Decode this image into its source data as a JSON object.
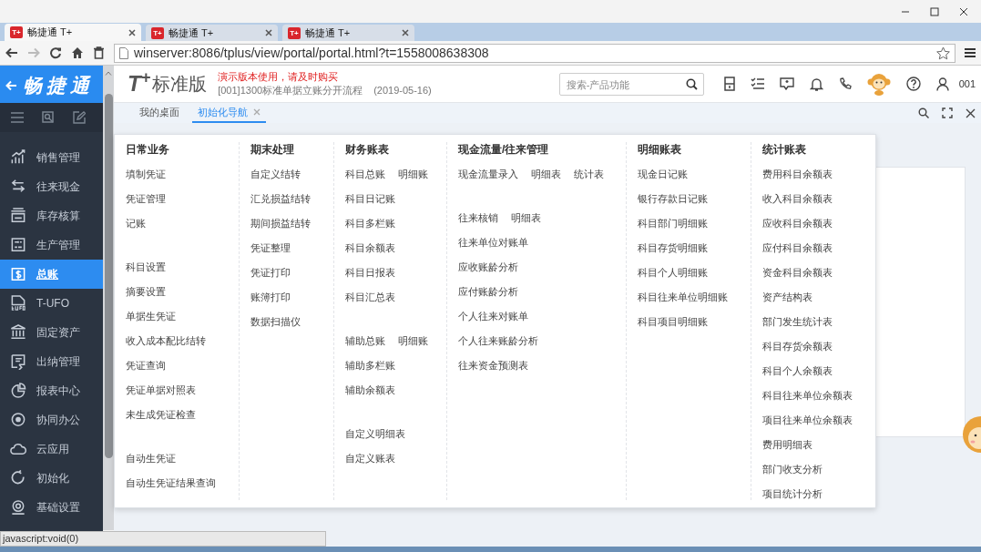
{
  "browser": {
    "tabs": [
      {
        "icon_text": "T+",
        "label": "畅捷通 T+",
        "selected": true
      },
      {
        "icon_text": "T+",
        "label": "畅捷通 T+",
        "selected": false
      },
      {
        "icon_text": "T+",
        "label": "畅捷通 T+",
        "selected": false
      }
    ],
    "address": "winserver:8086/tplus/view/portal/portal.html?t=1558008638308"
  },
  "header": {
    "brand": "畅捷通",
    "logo_mark": "T$^{+}$",
    "edition": "标准版",
    "notice": "演示版本使用，请及时购买",
    "account": "[001]1300标准单据立账分开流程",
    "date": "(2019-05-16)",
    "search": {
      "placeholder": "搜索-产品功能"
    },
    "user": "001"
  },
  "sidebar": {
    "items": [
      {
        "label": "销售管理",
        "selected": false
      },
      {
        "label": "往来现金",
        "selected": false
      },
      {
        "label": "库存核算",
        "selected": false
      },
      {
        "label": "生产管理",
        "selected": false
      },
      {
        "label": "总账",
        "selected": true
      },
      {
        "label": "T-UFO",
        "selected": false
      },
      {
        "label": "固定资产",
        "selected": false
      },
      {
        "label": "出纳管理",
        "selected": false
      },
      {
        "label": "报表中心",
        "selected": false
      },
      {
        "label": "协同办公",
        "selected": false
      },
      {
        "label": "云应用",
        "selected": false
      },
      {
        "label": "初始化",
        "selected": false
      },
      {
        "label": "基础设置",
        "selected": false
      }
    ]
  },
  "page_tabs": [
    {
      "label": "我的桌面",
      "selected": false,
      "closable": false
    },
    {
      "label": "初始化导航",
      "selected": true,
      "closable": true
    }
  ],
  "menu": {
    "columns": [
      {
        "heading": "日常业务",
        "groups": [
          [
            [
              "填制凭证"
            ],
            [
              "凭证管理"
            ],
            [
              "记账"
            ]
          ],
          [
            [
              "科目设置"
            ],
            [
              "摘要设置"
            ],
            [
              "单据生凭证"
            ],
            [
              "收入成本配比结转"
            ],
            [
              "凭证查询"
            ],
            [
              "凭证单据对照表"
            ],
            [
              "未生成凭证检查"
            ]
          ],
          [
            [
              "自动生凭证"
            ],
            [
              "自动生凭证结果查询"
            ]
          ]
        ]
      },
      {
        "heading": "期末处理",
        "groups": [
          [
            [
              "自定义结转"
            ],
            [
              "汇兑损益结转"
            ],
            [
              "期间损益结转"
            ],
            [
              "凭证整理"
            ],
            [
              "凭证打印"
            ],
            [
              "账簿打印"
            ],
            [
              "数据扫描仪"
            ]
          ]
        ]
      },
      {
        "heading": "财务账表",
        "groups": [
          [
            [
              "科目总账",
              "明细账"
            ],
            [
              "科目日记账"
            ],
            [
              "科目多栏账"
            ],
            [
              "科目余额表"
            ],
            [
              "科目日报表"
            ],
            [
              "科目汇总表"
            ]
          ],
          [
            [
              "辅助总账",
              "明细账"
            ],
            [
              "辅助多栏账"
            ],
            [
              "辅助余额表"
            ]
          ],
          [
            [
              "自定义明细表"
            ],
            [
              "自定义账表"
            ]
          ]
        ]
      },
      {
        "heading": "现金流量/往来管理",
        "groups": [
          [
            [
              "现金流量录入",
              "明细表",
              "统计表"
            ]
          ],
          [
            [
              "往来核销",
              "明细表"
            ],
            [
              "往来单位对账单"
            ],
            [
              "应收账龄分析"
            ],
            [
              "应付账龄分析"
            ],
            [
              "个人往来对账单"
            ],
            [
              "个人往来账龄分析"
            ],
            [
              "往来资金预测表"
            ]
          ]
        ]
      },
      {
        "heading": "明细账表",
        "groups": [
          [
            [
              "现金日记账"
            ],
            [
              "银行存款日记账"
            ],
            [
              "科目部门明细账"
            ],
            [
              "科目存货明细账"
            ],
            [
              "科目个人明细账"
            ],
            [
              "科目往来单位明细账"
            ],
            [
              "科目项目明细账"
            ]
          ]
        ]
      },
      {
        "heading": "统计账表",
        "groups": [
          [
            [
              "费用科目余额表"
            ],
            [
              "收入科目余额表"
            ],
            [
              "应收科目余额表"
            ],
            [
              "应付科目余额表"
            ],
            [
              "资金科目余额表"
            ],
            [
              "资产结构表"
            ],
            [
              "部门发生统计表"
            ],
            [
              "科目存货余额表"
            ],
            [
              "科目个人余额表"
            ],
            [
              "科目往来单位余额表"
            ],
            [
              "项目往来单位余额表"
            ],
            [
              "费用明细表"
            ],
            [
              "部门收支分析"
            ],
            [
              "项目统计分析"
            ]
          ]
        ]
      }
    ]
  },
  "status_bar": "javascript:void(0)"
}
